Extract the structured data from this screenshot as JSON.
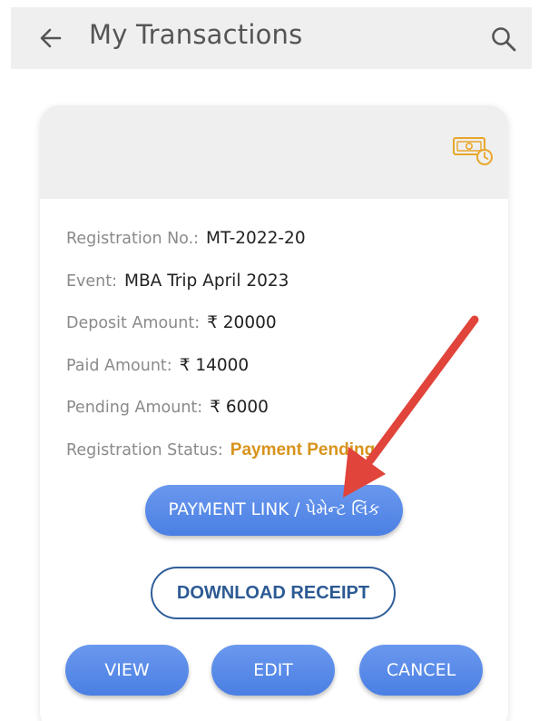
{
  "appbar": {
    "title": "My Transactions",
    "back_icon": "arrow-left-icon",
    "search_icon": "search-icon"
  },
  "card": {
    "icon": "money-clock-icon",
    "accent_color": "#e8a62a",
    "rows": [
      {
        "label": "Registration No.:",
        "value": "MT-2022-20"
      },
      {
        "label": "Event:",
        "value": "MBA Trip April 2023"
      },
      {
        "label": "Deposit Amount:",
        "value": "₹ 20000"
      },
      {
        "label": "Paid Amount:",
        "value": "₹ 14000"
      },
      {
        "label": "Pending Amount:",
        "value": "₹ 6000"
      },
      {
        "label": "Registration Status:",
        "value": "Payment Pending",
        "color": "#d8931c"
      }
    ]
  },
  "buttons": {
    "payment_link": "PAYMENT LINK / પેમેન્ટ લિંક",
    "download_receipt": "DOWNLOAD RECEIPT",
    "view": "VIEW",
    "edit": "EDIT",
    "cancel": "CANCEL"
  },
  "annotation": {
    "type": "red-arrow",
    "color": "#e0443a"
  }
}
